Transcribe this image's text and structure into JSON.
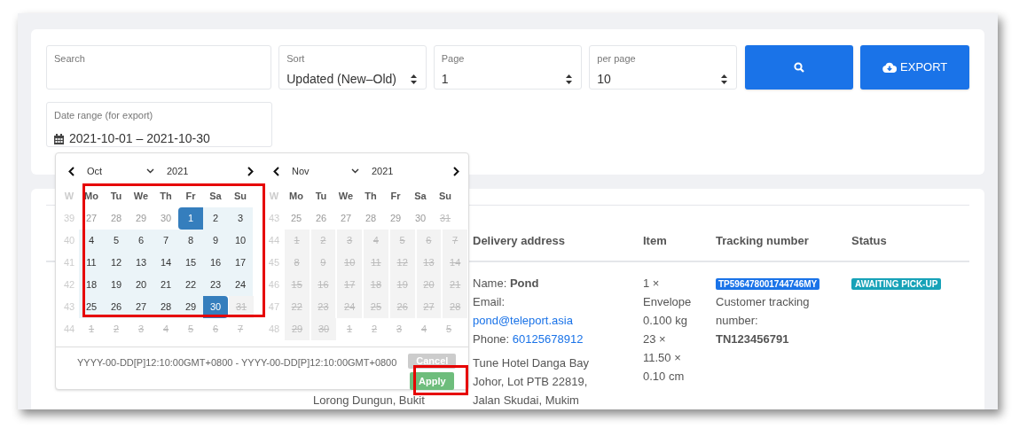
{
  "filters": {
    "search": {
      "label": "Search"
    },
    "sort": {
      "label": "Sort",
      "value": "Updated (New–Old)"
    },
    "page": {
      "label": "Page",
      "value": "1"
    },
    "per_page": {
      "label": "per page",
      "value": "10"
    },
    "export_button": "EXPORT",
    "date_range": {
      "label": "Date range (for export)",
      "value": "2021-10-01 – 2021-10-30"
    }
  },
  "date_picker": {
    "months": [
      {
        "month": "Oct",
        "year": "2021",
        "week_label": "W",
        "weekdays": [
          "Mo",
          "Tu",
          "We",
          "Th",
          "Fr",
          "Sa",
          "Su"
        ],
        "weeks": [
          {
            "number": "39",
            "days": [
              {
                "day": "27",
                "kind": "outside"
              },
              {
                "day": "28",
                "kind": "outside"
              },
              {
                "day": "29",
                "kind": "outside"
              },
              {
                "day": "30",
                "kind": "outside"
              },
              {
                "day": "1",
                "kind": "start"
              },
              {
                "day": "2",
                "kind": "in-range"
              },
              {
                "day": "3",
                "kind": "in-range"
              }
            ]
          },
          {
            "number": "40",
            "days": [
              {
                "day": "4",
                "kind": "in-range"
              },
              {
                "day": "5",
                "kind": "in-range"
              },
              {
                "day": "6",
                "kind": "in-range"
              },
              {
                "day": "7",
                "kind": "in-range"
              },
              {
                "day": "8",
                "kind": "in-range"
              },
              {
                "day": "9",
                "kind": "in-range"
              },
              {
                "day": "10",
                "kind": "in-range"
              }
            ]
          },
          {
            "number": "41",
            "days": [
              {
                "day": "11",
                "kind": "in-range"
              },
              {
                "day": "12",
                "kind": "in-range"
              },
              {
                "day": "13",
                "kind": "in-range"
              },
              {
                "day": "14",
                "kind": "in-range"
              },
              {
                "day": "15",
                "kind": "in-range"
              },
              {
                "day": "16",
                "kind": "in-range"
              },
              {
                "day": "17",
                "kind": "in-range"
              }
            ]
          },
          {
            "number": "42",
            "days": [
              {
                "day": "18",
                "kind": "in-range"
              },
              {
                "day": "19",
                "kind": "in-range"
              },
              {
                "day": "20",
                "kind": "in-range"
              },
              {
                "day": "21",
                "kind": "in-range"
              },
              {
                "day": "22",
                "kind": "in-range"
              },
              {
                "day": "23",
                "kind": "in-range"
              },
              {
                "day": "24",
                "kind": "in-range"
              }
            ]
          },
          {
            "number": "43",
            "days": [
              {
                "day": "25",
                "kind": "in-range"
              },
              {
                "day": "26",
                "kind": "in-range"
              },
              {
                "day": "27",
                "kind": "in-range"
              },
              {
                "day": "28",
                "kind": "in-range"
              },
              {
                "day": "29",
                "kind": "in-range"
              },
              {
                "day": "30",
                "kind": "end"
              },
              {
                "day": "31",
                "kind": "disabled"
              }
            ]
          },
          {
            "number": "44",
            "days": [
              {
                "day": "1",
                "kind": "outside-disabled"
              },
              {
                "day": "2",
                "kind": "outside-disabled"
              },
              {
                "day": "3",
                "kind": "outside-disabled"
              },
              {
                "day": "4",
                "kind": "outside-disabled"
              },
              {
                "day": "5",
                "kind": "outside-disabled"
              },
              {
                "day": "6",
                "kind": "outside-disabled"
              },
              {
                "day": "7",
                "kind": "outside-disabled"
              }
            ]
          }
        ]
      },
      {
        "month": "Nov",
        "year": "2021",
        "week_label": "W",
        "weekdays": [
          "Mo",
          "Tu",
          "We",
          "Th",
          "Fr",
          "Sa",
          "Su"
        ],
        "weeks": [
          {
            "number": "43",
            "days": [
              {
                "day": "25",
                "kind": "outside"
              },
              {
                "day": "26",
                "kind": "outside"
              },
              {
                "day": "27",
                "kind": "outside"
              },
              {
                "day": "28",
                "kind": "outside"
              },
              {
                "day": "29",
                "kind": "outside"
              },
              {
                "day": "30",
                "kind": "outside"
              },
              {
                "day": "31",
                "kind": "outside-disabled"
              }
            ]
          },
          {
            "number": "44",
            "days": [
              {
                "day": "1",
                "kind": "disabled"
              },
              {
                "day": "2",
                "kind": "disabled"
              },
              {
                "day": "3",
                "kind": "disabled"
              },
              {
                "day": "4",
                "kind": "disabled"
              },
              {
                "day": "5",
                "kind": "disabled"
              },
              {
                "day": "6",
                "kind": "disabled"
              },
              {
                "day": "7",
                "kind": "disabled"
              }
            ]
          },
          {
            "number": "45",
            "days": [
              {
                "day": "8",
                "kind": "disabled"
              },
              {
                "day": "9",
                "kind": "disabled"
              },
              {
                "day": "10",
                "kind": "disabled"
              },
              {
                "day": "11",
                "kind": "disabled"
              },
              {
                "day": "12",
                "kind": "disabled"
              },
              {
                "day": "13",
                "kind": "disabled"
              },
              {
                "day": "14",
                "kind": "disabled"
              }
            ]
          },
          {
            "number": "46",
            "days": [
              {
                "day": "15",
                "kind": "disabled"
              },
              {
                "day": "16",
                "kind": "disabled"
              },
              {
                "day": "17",
                "kind": "disabled"
              },
              {
                "day": "18",
                "kind": "disabled"
              },
              {
                "day": "19",
                "kind": "disabled"
              },
              {
                "day": "20",
                "kind": "disabled"
              },
              {
                "day": "21",
                "kind": "disabled"
              }
            ]
          },
          {
            "number": "47",
            "days": [
              {
                "day": "22",
                "kind": "disabled"
              },
              {
                "day": "23",
                "kind": "disabled"
              },
              {
                "day": "24",
                "kind": "disabled"
              },
              {
                "day": "25",
                "kind": "disabled"
              },
              {
                "day": "26",
                "kind": "disabled"
              },
              {
                "day": "27",
                "kind": "disabled"
              },
              {
                "day": "28",
                "kind": "disabled"
              }
            ]
          },
          {
            "number": "48",
            "days": [
              {
                "day": "29",
                "kind": "disabled"
              },
              {
                "day": "30",
                "kind": "disabled"
              },
              {
                "day": "1",
                "kind": "outside-disabled"
              },
              {
                "day": "2",
                "kind": "outside-disabled"
              },
              {
                "day": "3",
                "kind": "outside-disabled"
              },
              {
                "day": "4",
                "kind": "outside-disabled"
              },
              {
                "day": "5",
                "kind": "outside-disabled"
              }
            ]
          }
        ]
      }
    ],
    "format_text": "YYYY-00-DD[P]12:10:00GMT+0800 - YYYY-00-DD[P]12:10:00GMT+0800",
    "cancel_button": "Cancel",
    "apply_button": "Apply"
  },
  "table": {
    "columns": [
      "Delivery address",
      "Item",
      "Tracking number",
      "Status"
    ],
    "row": {
      "name_label": "Name:",
      "name": "Pond",
      "email_label": "Email:",
      "email": "pond@teleport.asia",
      "phone_label": "Phone:",
      "phone": "60125678912",
      "address": "Tune Hotel Danga Bay Johor, Lot PTB 22819, Jalan Skudai, Mukim",
      "item": [
        "1 ×",
        "Envelope",
        "0.100 kg",
        "23 ×",
        "11.50 ×",
        "0.10 cm"
      ],
      "tracking_badge": "TP596478001744746MY",
      "customer_tracking_label": "Customer tracking number:",
      "customer_tracking": "TN123456791",
      "status": "AWAITING PICK-UP"
    },
    "hidden_cell_text": "Lorong Dungun, Bukit"
  }
}
